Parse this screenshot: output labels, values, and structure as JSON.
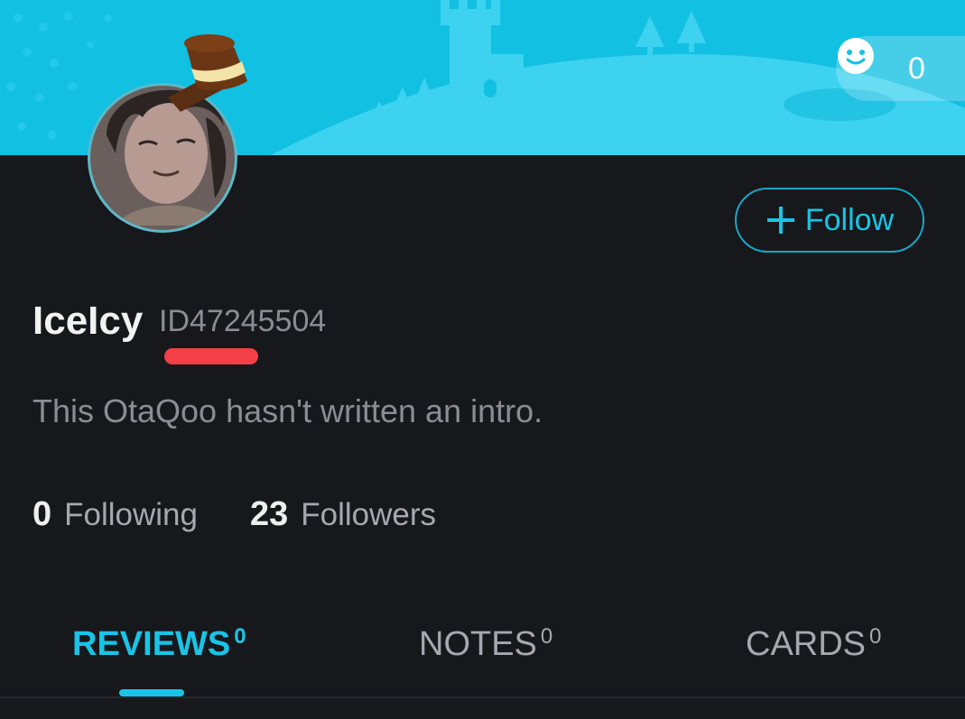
{
  "profile": {
    "username": "IceIcy",
    "user_id": "ID47245504",
    "intro": "This OtaQoo hasn't written an intro."
  },
  "likes": {
    "count": "0"
  },
  "follow_button": {
    "label": "Follow"
  },
  "stats": {
    "following_count": "0",
    "following_label": "Following",
    "followers_count": "23",
    "followers_label": "Followers"
  },
  "tabs": [
    {
      "label": "REVIEWS",
      "count": "0",
      "active": true
    },
    {
      "label": "NOTES",
      "count": "0",
      "active": false
    },
    {
      "label": "CARDS",
      "count": "0",
      "active": false
    }
  ],
  "colors": {
    "banner": "#12c0e2",
    "accent": "#19c4e6",
    "background": "#16181c",
    "highlight_mark": "#f33f46"
  },
  "icons": {
    "like": "smiley-face-icon",
    "follow": "plus-icon"
  }
}
